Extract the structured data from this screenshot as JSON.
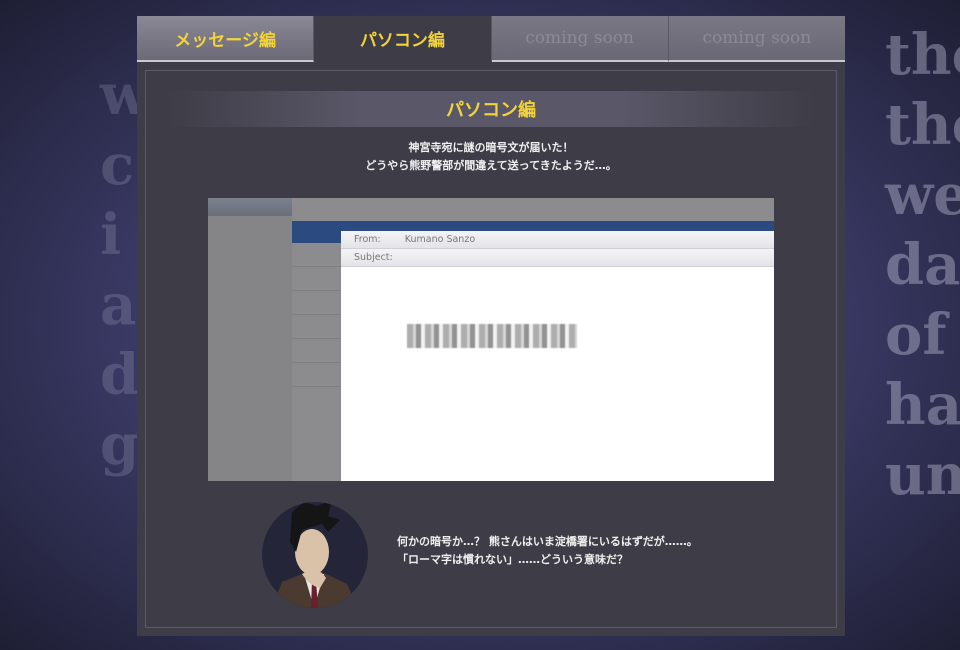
{
  "tabs": [
    {
      "label": "メッセージ編",
      "state": "inactive"
    },
    {
      "label": "パソコン編",
      "state": "active"
    },
    {
      "label": "coming soon",
      "state": "disabled"
    },
    {
      "label": "coming soon",
      "state": "disabled"
    }
  ],
  "section": {
    "title": "パソコン編",
    "intro": [
      "神宮寺宛に謎の暗号文が届いた！",
      "どうやら熊野警部が間違えて送ってきたようだ…。"
    ]
  },
  "email": {
    "from_label": "From:",
    "from_value": "Kumano Sanzo",
    "subject_label": "Subject:"
  },
  "character": {
    "icon": "detective-portrait",
    "lines": [
      "何かの暗号か…？ 熊さんはいま淀橋署にいるはずだが……。",
      "「ローマ字は慣れない」……どういう意味だ？"
    ]
  },
  "colors": {
    "accent": "#f2d43a",
    "panel": "#3e3c46"
  }
}
